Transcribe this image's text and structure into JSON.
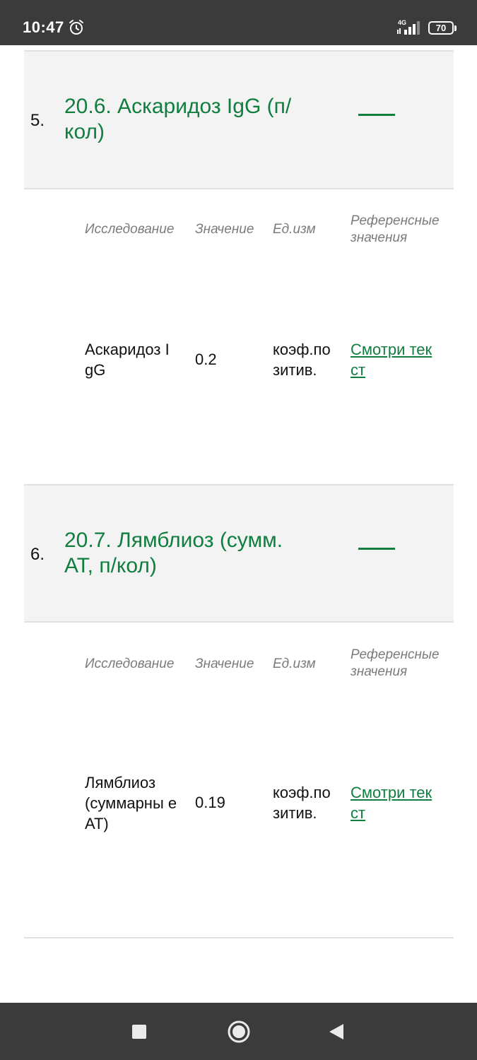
{
  "status_bar": {
    "time": "10:47",
    "alarm_icon": "alarm-clock-icon",
    "network_type": "4G",
    "signal_icon": "signal-bars-icon",
    "battery_level": "70"
  },
  "columns": {
    "study": "Исследование",
    "value": "Значение",
    "unit": "Ед.изм",
    "reference": "Референсные значения"
  },
  "groups": [
    {
      "number": "5.",
      "title": "20.6. Аскаридоз IgG (п/кол)",
      "result": {
        "study": "Аскаридоз I gG",
        "value": "0.2",
        "unit": "коэф.по зитив.",
        "reference_link": "Смотри тек ст"
      }
    },
    {
      "number": "6.",
      "title": "20.7. Лямблиоз (сумм. АТ, п/кол)",
      "result": {
        "study": "Лямблиоз (суммарны е АТ)",
        "value": "0.19",
        "unit": "коэф.по зитив.",
        "reference_link": "Смотри тек ст"
      }
    }
  ],
  "nav_bar": {
    "recents_icon": "square-recents-icon",
    "home_icon": "circle-home-icon",
    "back_icon": "triangle-back-icon"
  },
  "colors": {
    "accent_green": "#107e3e",
    "header_background": "#f3f3f4",
    "system_bar": "#3b3b3c"
  }
}
